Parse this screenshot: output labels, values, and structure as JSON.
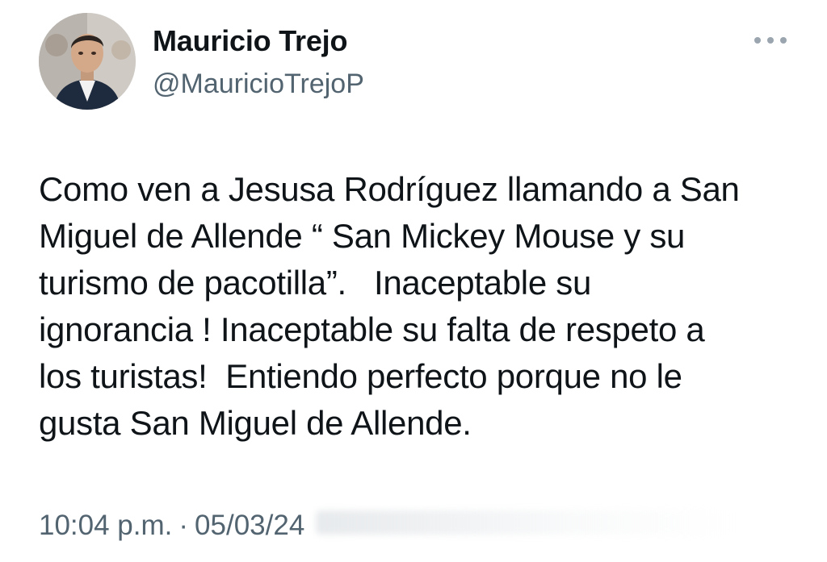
{
  "author": {
    "name": "Mauricio Trejo",
    "handle": "@MauricioTrejoP"
  },
  "tweet": {
    "text": "Como ven a Jesusa Rodríguez llamando a San\nMiguel de Allende “ San Mickey Mouse y su\nturismo de pacotilla”.   Inaceptable su\nignorancia ! Inaceptable su falta de respeto a\nlos turistas!  Entiendo perfecto porque no le\ngusta San Miguel de Allende.",
    "time": "10:04 p.m.",
    "separator": "·",
    "date": "05/03/24"
  },
  "icons": {
    "more": "more-horizontal-icon",
    "avatar": "user-avatar-photo"
  },
  "colors": {
    "name": "#0f1419",
    "secondary": "#536471",
    "more_dots": "#9aa5af",
    "background": "#ffffff"
  }
}
